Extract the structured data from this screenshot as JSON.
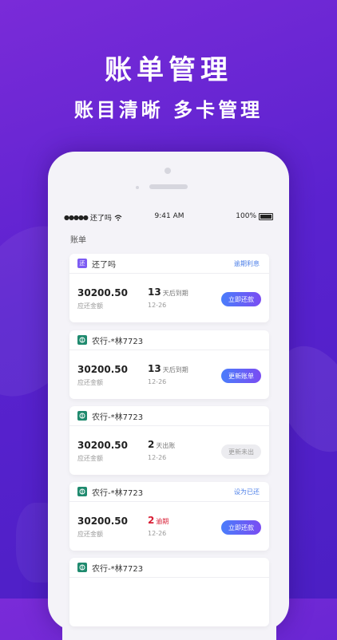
{
  "promo": {
    "headline": "账单管理",
    "subline": "账目清晰   多卡管理"
  },
  "status_bar": {
    "carrier": "还了吗",
    "time": "9:41 AM",
    "battery": "100%"
  },
  "page": {
    "title": "账单"
  },
  "cards": [
    {
      "icon": "还",
      "name": "还了吗",
      "head_link": "逾期利息",
      "amount": "30200.50",
      "amount_label": "应还金额",
      "days": "13",
      "days_text": "天后到期",
      "date": "12-26",
      "button": "立即还款"
    },
    {
      "icon": "",
      "name": "农行-*林7723",
      "head_link": "",
      "amount": "30200.50",
      "amount_label": "应还金额",
      "days": "13",
      "days_text": "天后到期",
      "date": "12-26",
      "button": "更新账单"
    },
    {
      "icon": "",
      "name": "农行-*林7723",
      "head_link": "",
      "amount": "30200.50",
      "amount_label": "应还金额",
      "days": "2",
      "days_text": "天出账",
      "date": "12-26",
      "button": "更新未出"
    },
    {
      "icon": "",
      "name": "农行-*林7723",
      "head_link": "设为已还",
      "amount": "30200.50",
      "amount_label": "应还金额",
      "days": "2",
      "days_text": "逾期",
      "date": "12-26",
      "button": "立即还款"
    },
    {
      "icon": "",
      "name": "农行-*林7723"
    }
  ],
  "colors": {
    "accent_gradient_start": "#4a7dfb",
    "accent_gradient_end": "#7a4cf2",
    "overdue_red": "#d81e35",
    "link_blue": "#4c7fe8"
  }
}
